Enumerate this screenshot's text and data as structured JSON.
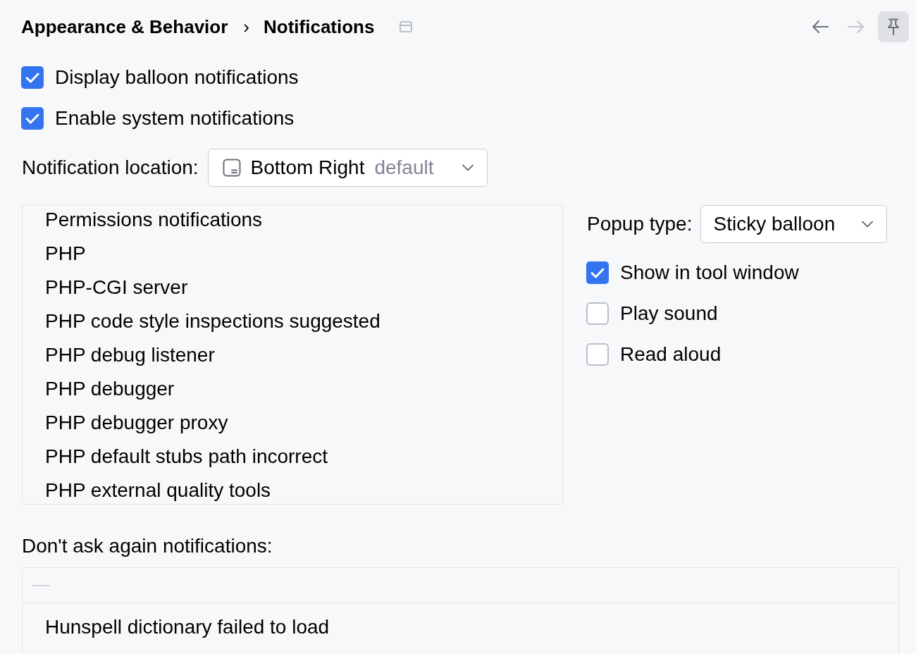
{
  "breadcrumb": {
    "items": [
      {
        "label": "Appearance & Behavior"
      },
      {
        "label": "Notifications"
      }
    ],
    "separator": "›"
  },
  "nav": {
    "back": {
      "disabled": false
    },
    "forward": {
      "disabled": true
    },
    "pin": {
      "selected": true
    }
  },
  "options": [
    {
      "label": "Display balloon notifications",
      "checked": true
    },
    {
      "label": "Enable system notifications",
      "checked": true
    }
  ],
  "notification_location": {
    "label": "Notification location:",
    "value": "Bottom Right",
    "hint": "default"
  },
  "groups": {
    "items": [
      {
        "label": "Permissions notifications",
        "selected": false
      },
      {
        "label": "PHP",
        "selected": false
      },
      {
        "label": "PHP-CGI server",
        "selected": false
      },
      {
        "label": "PHP code style inspections suggested",
        "selected": false
      },
      {
        "label": "PHP debug listener",
        "selected": false
      },
      {
        "label": "PHP debugger",
        "selected": false
      },
      {
        "label": "PHP debugger proxy",
        "selected": false
      },
      {
        "label": "PHP default stubs path incorrect",
        "selected": false
      },
      {
        "label": "PHP external quality tools",
        "selected": false
      }
    ]
  },
  "popup_type": {
    "label": "Popup type:",
    "value": "Sticky balloon"
  },
  "group_options": [
    {
      "label": "Show in tool window",
      "checked": true
    },
    {
      "label": "Play sound",
      "checked": false
    },
    {
      "label": "Read aloud",
      "checked": false
    }
  ],
  "dont_ask": {
    "label": "Don't ask again notifications:",
    "remove": {
      "disabled": true
    },
    "rows": [
      {
        "label": "Hunspell dictionary failed to load"
      }
    ]
  }
}
